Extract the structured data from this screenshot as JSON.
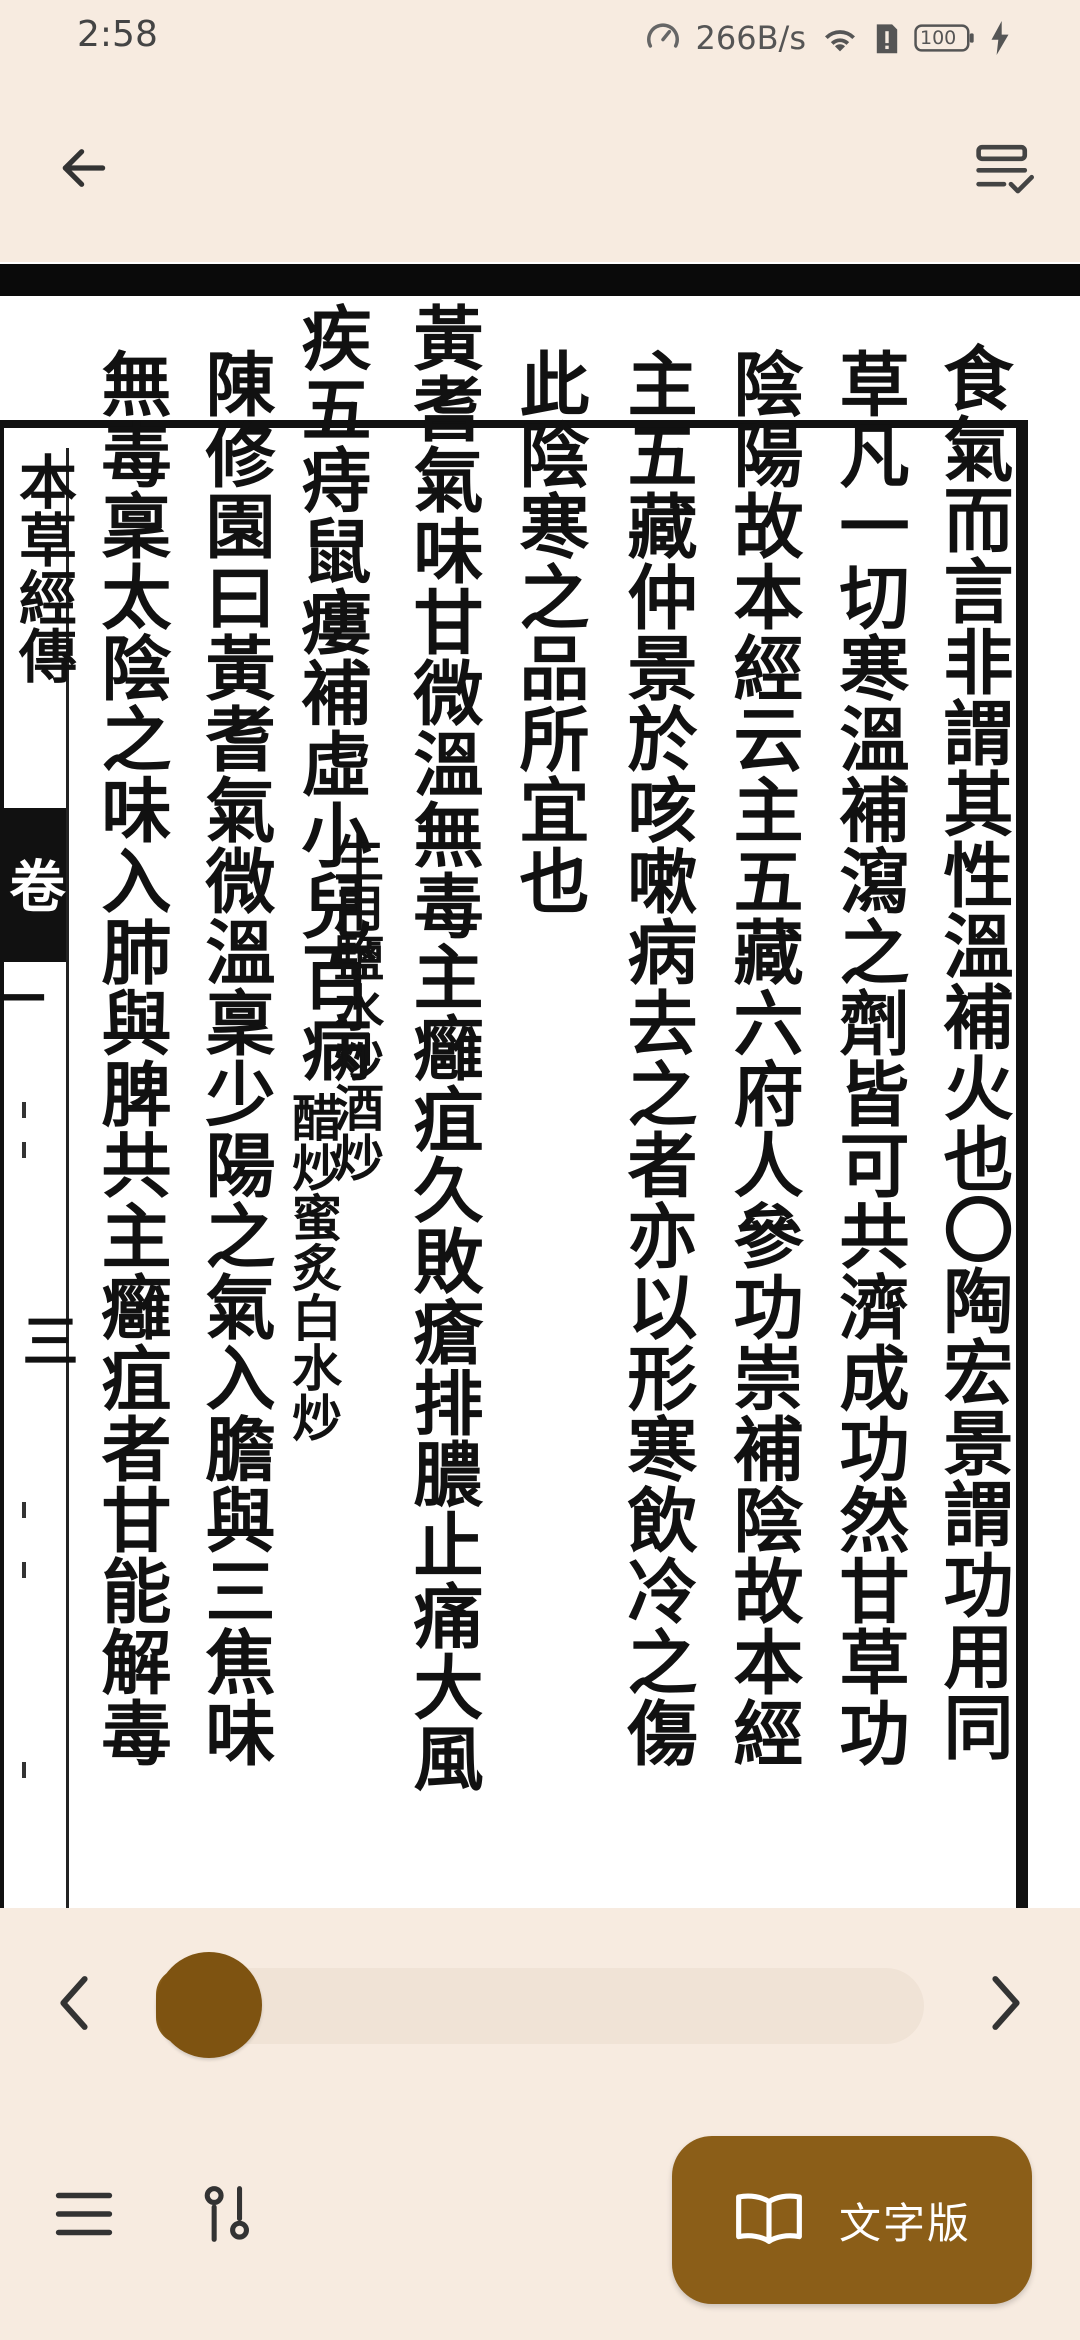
{
  "status_bar": {
    "time": "2:58",
    "net_speed": "266B/s",
    "battery": "100"
  },
  "app_bar": {
    "back_icon": "arrow-left-icon",
    "right_icon": "list-check-icon"
  },
  "scan": {
    "margin_title": "本草經傳",
    "volume_label": "卷",
    "volume_number": "一",
    "page_number": "三",
    "columns": [
      "食氣而言非謂其性溫補火也〇陶宏景謂功用同",
      "草凡一切寒溫補瀉之劑皆可共濟成功然甘草功",
      "陰陽故本經云主五藏六府人參功崇補陰故本經",
      "主五藏仲景於咳嗽病去之者亦以形寒飲冷之傷",
      "此陰寒之品所宜也",
      "黃耆氣味甘微溫無毒主癰疽久敗瘡排膿止痛大風",
      "疾五痔鼠瘻補虛小兒百病",
      "陳修園曰黃耆氣微溫稟少陽之氣入膽與三焦味",
      "無毒稟太陰之味入肺與脾共主癰疽者甘能解毒"
    ],
    "annotation_right": "生用鹽水炒酒炒",
    "annotation_left": "醋炒蜜炙白水炒"
  },
  "reader_controls": {
    "progress": 0.06,
    "prev_icon": "chevron-left-icon",
    "next_icon": "chevron-right-icon"
  },
  "bottom_bar": {
    "menu_icon": "hamburger-menu-icon",
    "adjust_icon": "adjust-settings-icon",
    "text_version_label": "文字版",
    "text_version_icon": "open-book-icon"
  }
}
